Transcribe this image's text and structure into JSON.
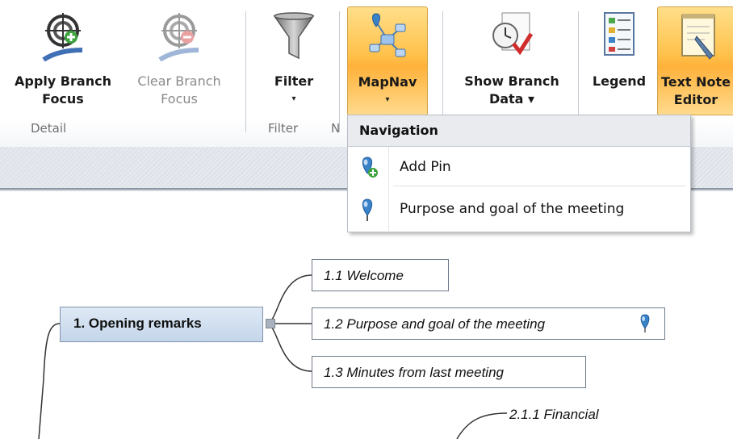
{
  "ribbon": {
    "buttons": [
      {
        "label1": "Apply Branch",
        "label2": "Focus",
        "icon": "target-plus-icon"
      },
      {
        "label1": "Clear Branch",
        "label2": "Focus",
        "icon": "target-minus-icon"
      },
      {
        "label1": "Filter",
        "label2": "▾",
        "icon": "funnel-icon"
      },
      {
        "label1": "MapNav",
        "label2": "▾",
        "icon": "network-nav-icon"
      },
      {
        "label1": "Show Branch",
        "label2": "Data ▾",
        "icon": "clock-check-icon"
      },
      {
        "label1": "Legend",
        "label2": "",
        "icon": "legend-icon"
      },
      {
        "label1": "Text Note",
        "label2": "Editor",
        "icon": "note-editor-icon"
      }
    ],
    "groups": {
      "detail": "Detail",
      "filter": "Filter",
      "nav_partial": "N"
    }
  },
  "menu": {
    "header": "Navigation",
    "items": [
      {
        "label": "Add Pin",
        "icon": "add-pin-icon"
      },
      {
        "label": "Purpose and goal of the meeting",
        "icon": "pin-icon"
      }
    ]
  },
  "mindmap": {
    "main_topic": "1.  Opening remarks",
    "subtopics": [
      "1.1  Welcome",
      "1.2  Purpose and goal of the meeting",
      "1.3  Minutes from last meeting"
    ],
    "floating": "2.1.1  Financial"
  },
  "colors": {
    "accent": "#ffc14a",
    "topic_fill": "#c4d6ea",
    "pin": "#3a83c8"
  }
}
